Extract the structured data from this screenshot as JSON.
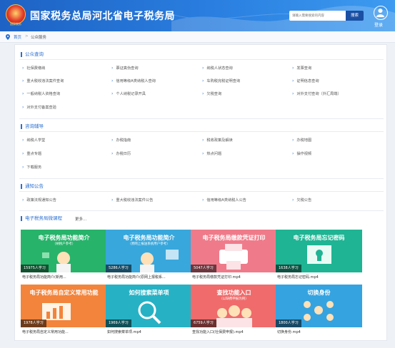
{
  "header": {
    "emblem_text": "国家税务",
    "title": "国家税务总局河北省电子税务局",
    "search_placeholder": "请输入需要搜索的内容",
    "search_label": "搜索",
    "login_label": "登录"
  },
  "breadcrumb": {
    "home": "首页",
    "separator": ">",
    "current": "公众服务"
  },
  "sections": {
    "public_query": {
      "title": "公众查询",
      "links": [
        "社保费缴纳",
        "票证真伪查询",
        "纳税人状态查询",
        "发票查询",
        "重大税收违法案件查询",
        "信用等级A类纳税人查询",
        "车购税完税证明查询",
        "证明信息查询",
        "一般纳税人资格查询",
        "个人纳税记录开具",
        "欠税查询",
        "对外支付查询（外汇局端）",
        "对外支付备案查验"
      ]
    },
    "tax_guide": {
      "title": "咨询辅导",
      "links": [
        "纳税人学堂",
        "办税指南",
        "税收政策及解读",
        "办税地图",
        "重点专题",
        "办税日历",
        "热点问题",
        "操作视频",
        "下载服务"
      ]
    },
    "notices": {
      "title": "通知公告",
      "links": [
        "政策法规通知公告",
        "重大税收违法案件公告",
        "信用等级A类纳税人公告",
        "欠税公告"
      ]
    },
    "courses": {
      "title": "电子税务局微课程",
      "more_label": "更多...",
      "items": [
        {
          "title": "电子税务局功能简介",
          "subtitle": "（纳税户参考）",
          "learners": "15975人学习",
          "caption": "电子税务局功能简介(新用...",
          "color": "#27b36a"
        },
        {
          "title": "电子税务局功能简介",
          "subtitle": "（原网上报送系统用户参考）",
          "learners": "5286人学习",
          "caption": "电子税务局功能简介(原网上报税系...",
          "color": "#38a7dc"
        },
        {
          "title": "电子税务局缴款凭证打印",
          "subtitle": "",
          "learners": "5047人学习",
          "caption": "电子税务局缴款凭证打印.mp4",
          "color": "#ef7b8a"
        },
        {
          "title": "电子税务局忘记密码",
          "subtitle": "",
          "learners": "1638人学习",
          "caption": "电子税务局忘记密码.mp4",
          "color": "#1fb493"
        },
        {
          "title": "电子税务局自定义常用功能",
          "subtitle": "",
          "learners": "1978人学习",
          "caption": "电子税务局自定义常用功能...",
          "color": "#f2843c"
        },
        {
          "title": "如何搜索菜单项",
          "subtitle": "",
          "learners": "1969人学习",
          "caption": "如何搜索菜单项.mp4",
          "color": "#27b1c4"
        },
        {
          "title": "查找功能入口",
          "subtitle": "（以缺费申报为例）",
          "learners": "6759人学习",
          "caption": "查找功能入口(社保费申报).mp4",
          "color": "#f06b6b"
        },
        {
          "title": "切换身份",
          "subtitle": "",
          "learners": "1800人学习",
          "caption": "切换身份.mp4",
          "color": "#35a3e0"
        }
      ]
    }
  },
  "colors": {
    "header": "#2a7fe0",
    "accent": "#2a6fd2"
  }
}
